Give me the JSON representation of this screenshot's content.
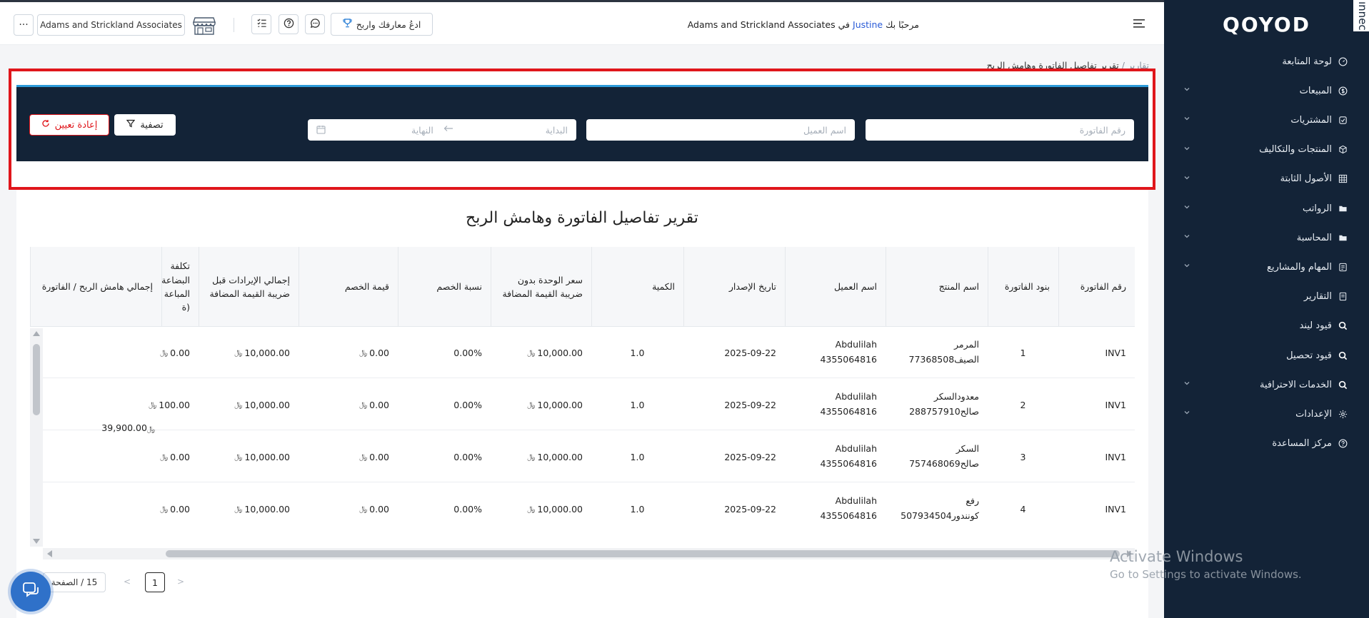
{
  "app": {
    "logo": "QOYOD",
    "corner_text": "ınnec"
  },
  "header": {
    "welcome_prefix": "مرحبًا بك",
    "user_name": "Justine",
    "welcome_in": "في",
    "company_name": "Adams and Strickland Associates",
    "promo_label": "ادعُ معارفك واربح",
    "company_select_value": "Adams and Strickland Associates",
    "more_label": "···"
  },
  "sidebar": {
    "items": [
      {
        "label": "لوحة المتابعة",
        "icon": "dashboard-icon",
        "chevron": false
      },
      {
        "label": "المبيعات",
        "icon": "dollar-circle-icon",
        "chevron": true
      },
      {
        "label": "المشتريات",
        "icon": "cart-icon",
        "chevron": true
      },
      {
        "label": "المنتجات والتكاليف",
        "icon": "box-icon",
        "chevron": true
      },
      {
        "label": "الأصول الثابتة",
        "icon": "grid-icon",
        "chevron": true
      },
      {
        "label": "الرواتب",
        "icon": "folder-icon",
        "chevron": true
      },
      {
        "label": "المحاسبة",
        "icon": "folder-icon",
        "chevron": true
      },
      {
        "label": "المهام والمشاريع",
        "icon": "tasks-icon",
        "chevron": true
      },
      {
        "label": "التقارير",
        "icon": "report-icon",
        "chevron": false
      },
      {
        "label": "قيود ليند",
        "icon": "search-icon",
        "chevron": false
      },
      {
        "label": "قيود تحصيل",
        "icon": "search-icon",
        "chevron": false
      },
      {
        "label": "الخدمات الاحترافية",
        "icon": "search-icon",
        "chevron": true
      },
      {
        "label": "الإعدادات",
        "icon": "gear-icon",
        "chevron": true
      },
      {
        "label": "مركز المساعدة",
        "icon": "help-icon",
        "chevron": false
      }
    ]
  },
  "breadcrumb": {
    "parent": "تقارير",
    "separator": "/",
    "current": "تقرير تفاصيل الفاتورة وهامش الربح"
  },
  "filters": {
    "invoice_number_placeholder": "رقم الفاتورة",
    "customer_name_placeholder": "اسم العميل",
    "date_start_placeholder": "البداية",
    "date_end_placeholder": "النهاية",
    "filter_label": "تصفية",
    "reset_label": "إعادة تعيين"
  },
  "report": {
    "title": "تقرير تفاصيل الفاتورة وهامش الربح",
    "columns": [
      "رقم الفاتورة",
      "بنود الفاتورة",
      "اسم المنتج",
      "اسم العميل",
      "تاريخ الإصدار",
      "الكمية",
      "سعر الوحدة بدون ضريبة القيمة المضافة",
      "نسبة الخصم",
      "قيمة الخصم",
      "إجمالي الإيرادات قبل ضريبة القيمة المضافة",
      "تكلفة البضاعة المباعة (ة",
      "إجمالي هامش الربح / الفاتورة"
    ],
    "rows": [
      {
        "invoice": "INV1",
        "line": "1",
        "product_1": "المرمر",
        "product_2": "الصيف77368508",
        "customer_1": "Abdulilah",
        "customer_2": "4355064816",
        "date": "2025-09-22",
        "qty": "1.0",
        "unit_price": "10,000.00",
        "discount_pct": "0.00%",
        "discount_val": "0.00",
        "revenue": "10,000.00",
        "cogs": "0.00"
      },
      {
        "invoice": "INV1",
        "line": "2",
        "product_1": "معدودالسكر",
        "product_2": "صالح288757910",
        "customer_1": "Abdulilah",
        "customer_2": "4355064816",
        "date": "2025-09-22",
        "qty": "1.0",
        "unit_price": "10,000.00",
        "discount_pct": "0.00%",
        "discount_val": "0.00",
        "revenue": "10,000.00",
        "cogs": "100.00"
      },
      {
        "invoice": "INV1",
        "line": "3",
        "product_1": "السكر",
        "product_2": "صالح757468069",
        "customer_1": "Abdulilah",
        "customer_2": "4355064816",
        "date": "2025-09-22",
        "qty": "1.0",
        "unit_price": "10,000.00",
        "discount_pct": "0.00%",
        "discount_val": "0.00",
        "revenue": "10,000.00",
        "cogs": "0.00"
      },
      {
        "invoice": "INV1",
        "line": "4",
        "product_1": "رفع",
        "product_2": "كونندور507934504",
        "customer_1": "Abdulilah",
        "customer_2": "4355064816",
        "date": "2025-09-22",
        "qty": "1.0",
        "unit_price": "10,000.00",
        "discount_pct": "0.00%",
        "discount_val": "0.00",
        "revenue": "10,000.00",
        "cogs": "0.00"
      }
    ],
    "total_margin": "39,900.00",
    "currency_symbol": "﷼"
  },
  "pagination": {
    "page_size_label": "15 / الصفحة",
    "current_page": "1",
    "prev": "<",
    "next": ">"
  },
  "watermark": {
    "line1": "Activate Windows",
    "line2": "Go to Settings to activate Windows."
  },
  "colors": {
    "sidebar_bg": "#132337",
    "filter_bg": "#132337",
    "accent_blue": "#2a5bd7",
    "highlight_red": "#e0161b",
    "filter_top_border": "#2d9bd9"
  }
}
